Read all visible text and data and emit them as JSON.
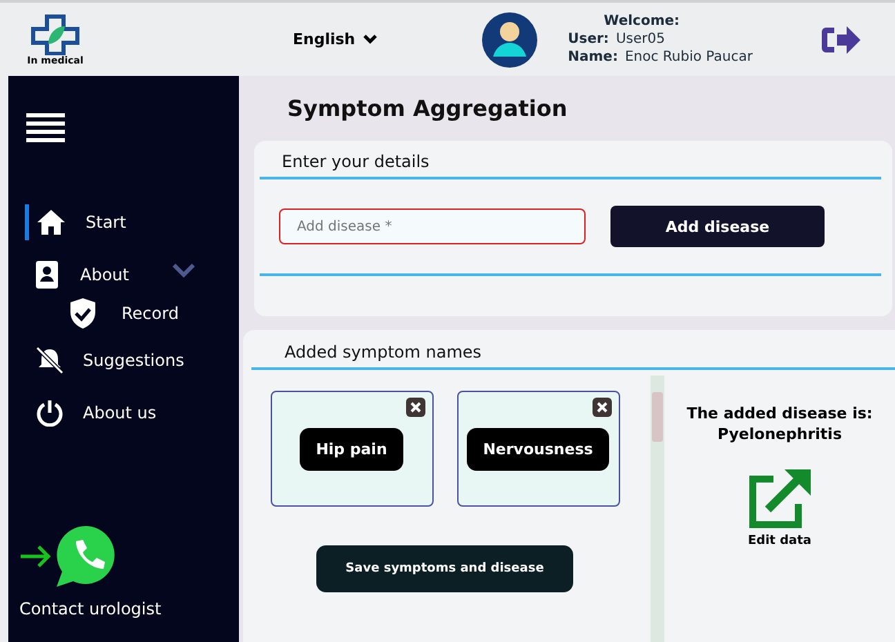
{
  "header": {
    "logo_caption": "In medical",
    "language": "English",
    "welcome": "Welcome:",
    "user_label": "User:",
    "user": "User05",
    "name_label": "Name:",
    "name": "Enoc Rubio Paucar"
  },
  "sidebar": {
    "items": [
      {
        "label": "Start",
        "selected": true
      },
      {
        "label": "About",
        "selected": false,
        "expanded": true,
        "children": [
          {
            "label": "Record",
            "selected": false
          }
        ]
      },
      {
        "label": "Suggestions",
        "selected": false
      },
      {
        "label": "About us",
        "selected": false
      }
    ],
    "contact": "Contact urologist"
  },
  "title": "Symptom Aggregation",
  "details": {
    "heading": "Enter your details",
    "field": {
      "placeholder": "Add disease *",
      "invalid": true
    },
    "button": "Add disease"
  },
  "symptoms": {
    "heading": "Added symptom names",
    "items": [
      "Hip pain",
      "Nervousness"
    ],
    "save_button": "Save symptoms and disease",
    "disease_label": "The added disease is:",
    "disease": "Pyelonephritis",
    "edit": "Edit data"
  }
}
